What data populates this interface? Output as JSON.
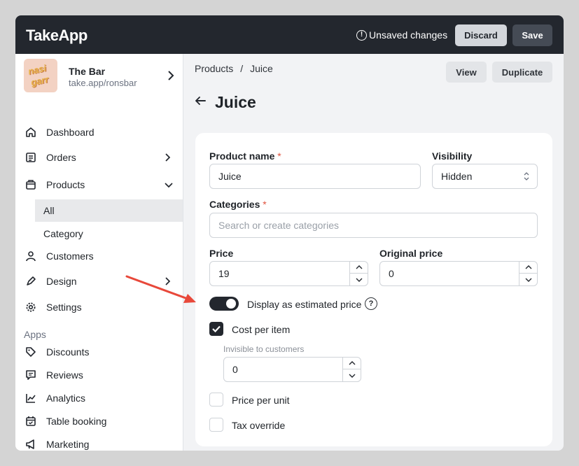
{
  "app": {
    "logo": "TakeApp"
  },
  "topbar": {
    "unsaved_icon": "alert-circle-icon",
    "unsaved_text": "Unsaved changes",
    "discard_label": "Discard",
    "save_label": "Save"
  },
  "store": {
    "avatar_text": "nasi garr",
    "name": "The Bar",
    "url": "take.app/ronsbar"
  },
  "sidebar": {
    "items": [
      {
        "label": "Dashboard",
        "icon": "home-icon"
      },
      {
        "label": "Orders",
        "icon": "orders-icon"
      },
      {
        "label": "Products",
        "icon": "products-icon"
      },
      {
        "label": "All"
      },
      {
        "label": "Category"
      },
      {
        "label": "Customers",
        "icon": "user-icon"
      },
      {
        "label": "Design",
        "icon": "pen-icon"
      },
      {
        "label": "Settings",
        "icon": "gear-icon"
      }
    ],
    "apps_label": "Apps",
    "apps": [
      {
        "label": "Discounts",
        "icon": "tag-icon"
      },
      {
        "label": "Reviews",
        "icon": "message-icon"
      },
      {
        "label": "Analytics",
        "icon": "chart-icon"
      },
      {
        "label": "Table booking",
        "icon": "calendar-icon"
      },
      {
        "label": "Marketing",
        "icon": "megaphone-icon"
      }
    ]
  },
  "main": {
    "breadcrumb": {
      "parent": "Products",
      "separator": "/",
      "current": "Juice"
    },
    "view_label": "View",
    "duplicate_label": "Duplicate",
    "title": "Juice"
  },
  "form": {
    "product_name_label": "Product name",
    "required_mark": "*",
    "product_name_value": "Juice",
    "visibility_label": "Visibility",
    "visibility_value": "Hidden",
    "categories_label": "Categories",
    "categories_placeholder": "Search or create categories",
    "price_label": "Price",
    "price_value": "19",
    "original_price_label": "Original price",
    "original_price_value": "0",
    "estimated_price_label": "Display as estimated price",
    "estimated_price_on": true,
    "help_glyph": "?",
    "cost_per_item_label": "Cost per item",
    "cost_per_item_checked": true,
    "cost_hint": "Invisible to customers",
    "cost_value": "0",
    "price_per_unit_label": "Price per unit",
    "tax_override_label": "Tax override"
  },
  "colors": {
    "topbar": "#23272e",
    "accent_required": "#e0533f",
    "annotation_arrow": "#e8483a"
  }
}
